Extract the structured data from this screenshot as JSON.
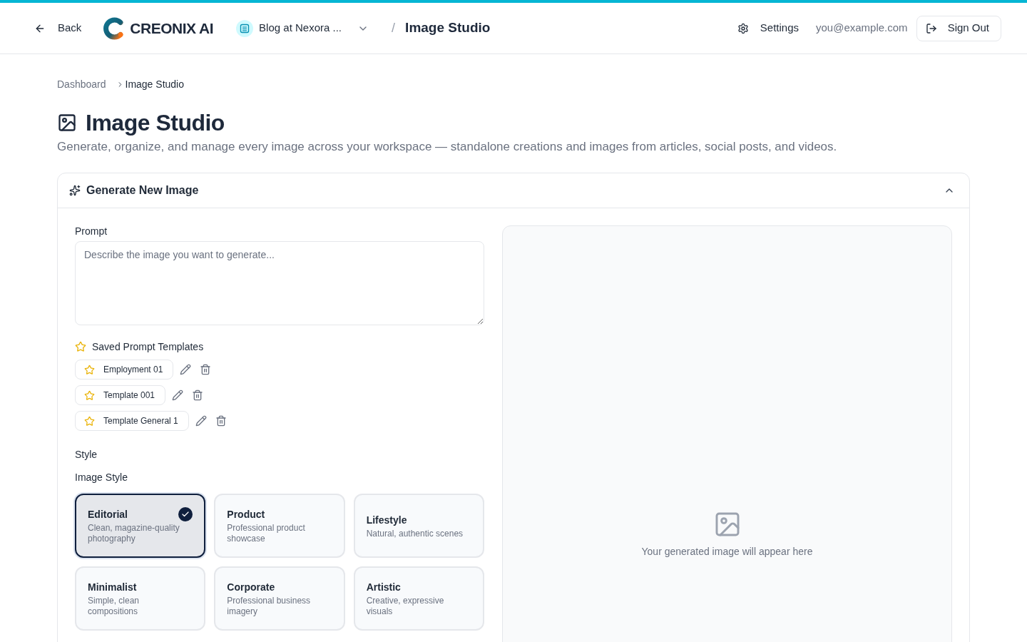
{
  "header": {
    "back": "Back",
    "brand": "CREONIX AI",
    "workspace": "Blog at Nexora ...",
    "separator": "/",
    "page": "Image Studio",
    "settings": "Settings",
    "email": "you@example.com",
    "sign_out": "Sign Out"
  },
  "breadcrumb": [
    "Dashboard",
    "Image Studio"
  ],
  "page": {
    "title": "Image Studio",
    "subtitle": "Generate, organize, and manage every image across your workspace — standalone creations and images from articles, social posts, and videos."
  },
  "generator": {
    "title": "Generate New Image",
    "expanded": true,
    "prompt": {
      "label": "Prompt",
      "placeholder": "Describe the image you want to generate..."
    },
    "templates": {
      "title": "Saved Prompt Templates",
      "items": [
        "Employment 01",
        "Template 001",
        "Template General 1"
      ]
    },
    "style": {
      "section": "Style",
      "label": "Image Style",
      "options": [
        {
          "name": "Editorial",
          "description": "Clean, magazine-quality photography",
          "selected": true
        },
        {
          "name": "Product",
          "description": "Professional product showcase",
          "selected": false
        },
        {
          "name": "Lifestyle",
          "description": "Natural, authentic scenes",
          "selected": false
        },
        {
          "name": "Minimalist",
          "description": "Simple, clean compositions",
          "selected": false
        },
        {
          "name": "Corporate",
          "description": "Professional business imagery",
          "selected": false
        },
        {
          "name": "Artistic",
          "description": "Creative, expressive visuals",
          "selected": false
        }
      ]
    }
  },
  "preview": {
    "empty_text": "Your generated image will appear here"
  }
}
